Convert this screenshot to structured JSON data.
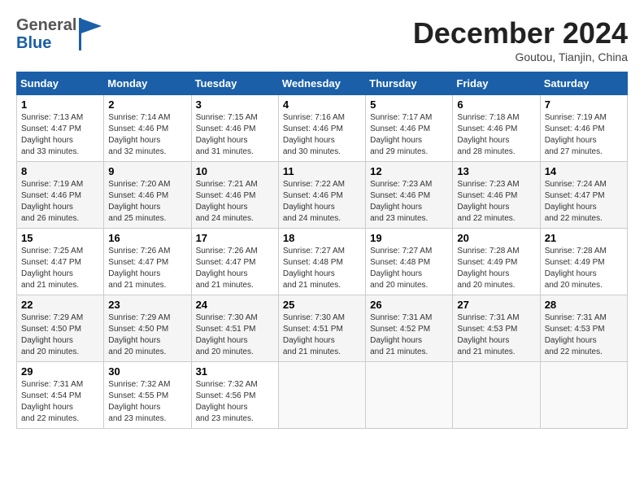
{
  "header": {
    "logo_general": "General",
    "logo_blue": "Blue",
    "month": "December 2024",
    "location": "Goutou, Tianjin, China"
  },
  "weekdays": [
    "Sunday",
    "Monday",
    "Tuesday",
    "Wednesday",
    "Thursday",
    "Friday",
    "Saturday"
  ],
  "weeks": [
    [
      {
        "day": "1",
        "sunrise": "7:13 AM",
        "sunset": "4:47 PM",
        "daylight": "9 hours and 33 minutes."
      },
      {
        "day": "2",
        "sunrise": "7:14 AM",
        "sunset": "4:46 PM",
        "daylight": "9 hours and 32 minutes."
      },
      {
        "day": "3",
        "sunrise": "7:15 AM",
        "sunset": "4:46 PM",
        "daylight": "9 hours and 31 minutes."
      },
      {
        "day": "4",
        "sunrise": "7:16 AM",
        "sunset": "4:46 PM",
        "daylight": "9 hours and 30 minutes."
      },
      {
        "day": "5",
        "sunrise": "7:17 AM",
        "sunset": "4:46 PM",
        "daylight": "9 hours and 29 minutes."
      },
      {
        "day": "6",
        "sunrise": "7:18 AM",
        "sunset": "4:46 PM",
        "daylight": "9 hours and 28 minutes."
      },
      {
        "day": "7",
        "sunrise": "7:19 AM",
        "sunset": "4:46 PM",
        "daylight": "9 hours and 27 minutes."
      }
    ],
    [
      {
        "day": "8",
        "sunrise": "7:19 AM",
        "sunset": "4:46 PM",
        "daylight": "9 hours and 26 minutes."
      },
      {
        "day": "9",
        "sunrise": "7:20 AM",
        "sunset": "4:46 PM",
        "daylight": "9 hours and 25 minutes."
      },
      {
        "day": "10",
        "sunrise": "7:21 AM",
        "sunset": "4:46 PM",
        "daylight": "9 hours and 24 minutes."
      },
      {
        "day": "11",
        "sunrise": "7:22 AM",
        "sunset": "4:46 PM",
        "daylight": "9 hours and 24 minutes."
      },
      {
        "day": "12",
        "sunrise": "7:23 AM",
        "sunset": "4:46 PM",
        "daylight": "9 hours and 23 minutes."
      },
      {
        "day": "13",
        "sunrise": "7:23 AM",
        "sunset": "4:46 PM",
        "daylight": "9 hours and 22 minutes."
      },
      {
        "day": "14",
        "sunrise": "7:24 AM",
        "sunset": "4:47 PM",
        "daylight": "9 hours and 22 minutes."
      }
    ],
    [
      {
        "day": "15",
        "sunrise": "7:25 AM",
        "sunset": "4:47 PM",
        "daylight": "9 hours and 21 minutes."
      },
      {
        "day": "16",
        "sunrise": "7:26 AM",
        "sunset": "4:47 PM",
        "daylight": "9 hours and 21 minutes."
      },
      {
        "day": "17",
        "sunrise": "7:26 AM",
        "sunset": "4:47 PM",
        "daylight": "9 hours and 21 minutes."
      },
      {
        "day": "18",
        "sunrise": "7:27 AM",
        "sunset": "4:48 PM",
        "daylight": "9 hours and 21 minutes."
      },
      {
        "day": "19",
        "sunrise": "7:27 AM",
        "sunset": "4:48 PM",
        "daylight": "9 hours and 20 minutes."
      },
      {
        "day": "20",
        "sunrise": "7:28 AM",
        "sunset": "4:49 PM",
        "daylight": "9 hours and 20 minutes."
      },
      {
        "day": "21",
        "sunrise": "7:28 AM",
        "sunset": "4:49 PM",
        "daylight": "9 hours and 20 minutes."
      }
    ],
    [
      {
        "day": "22",
        "sunrise": "7:29 AM",
        "sunset": "4:50 PM",
        "daylight": "9 hours and 20 minutes."
      },
      {
        "day": "23",
        "sunrise": "7:29 AM",
        "sunset": "4:50 PM",
        "daylight": "9 hours and 20 minutes."
      },
      {
        "day": "24",
        "sunrise": "7:30 AM",
        "sunset": "4:51 PM",
        "daylight": "9 hours and 20 minutes."
      },
      {
        "day": "25",
        "sunrise": "7:30 AM",
        "sunset": "4:51 PM",
        "daylight": "9 hours and 21 minutes."
      },
      {
        "day": "26",
        "sunrise": "7:31 AM",
        "sunset": "4:52 PM",
        "daylight": "9 hours and 21 minutes."
      },
      {
        "day": "27",
        "sunrise": "7:31 AM",
        "sunset": "4:53 PM",
        "daylight": "9 hours and 21 minutes."
      },
      {
        "day": "28",
        "sunrise": "7:31 AM",
        "sunset": "4:53 PM",
        "daylight": "9 hours and 22 minutes."
      }
    ],
    [
      {
        "day": "29",
        "sunrise": "7:31 AM",
        "sunset": "4:54 PM",
        "daylight": "9 hours and 22 minutes."
      },
      {
        "day": "30",
        "sunrise": "7:32 AM",
        "sunset": "4:55 PM",
        "daylight": "9 hours and 23 minutes."
      },
      {
        "day": "31",
        "sunrise": "7:32 AM",
        "sunset": "4:56 PM",
        "daylight": "9 hours and 23 minutes."
      },
      null,
      null,
      null,
      null
    ]
  ]
}
